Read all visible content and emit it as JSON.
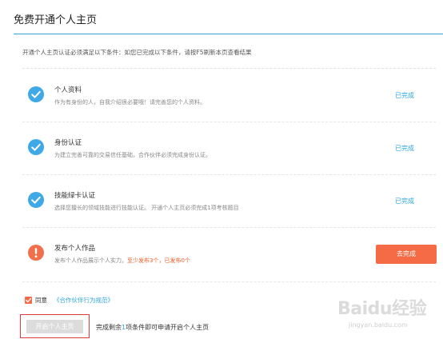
{
  "header": {
    "title": "免费开通个人主页"
  },
  "intro": {
    "text": "开通个人主页认证必须满足以下条件：如您已完成以下条件，请按F5刷新本页查看结果"
  },
  "requirements": [
    {
      "name": "个人资料",
      "description": "作为有身份的人，自我介绍很必要哦！请完善您的个人资料。",
      "status": "done",
      "status_label": "已完成",
      "icon": "check-circle-icon"
    },
    {
      "name": "身份认证",
      "description": "为建立完善可靠的交易信任基础，合作伙伴必须完成身份认证。",
      "status": "done",
      "status_label": "已完成",
      "icon": "check-circle-icon"
    },
    {
      "name": "技能绿卡认证",
      "description": "选择您擅长的领域技能进行技能认证。  开通个人主页必须完成1项考核题目",
      "status": "done",
      "status_label": "已完成",
      "icon": "check-circle-icon"
    },
    {
      "name": "发布个人作品",
      "description_prefix": "发布个人作品展示个人实力。",
      "description_warning": "至少发布3个，已发布0个",
      "status": "todo",
      "action_label": "去完成",
      "icon": "exclamation-circle-icon"
    }
  ],
  "agreement": {
    "checked": true,
    "label": "同意",
    "link_text": "《合作伙伴行为规范》"
  },
  "open_homepage": {
    "button_label": "开启个人主页",
    "hint_prefix": "完成剩余",
    "hint_number": "1",
    "hint_suffix": "项条件即可申请开启个人主页"
  },
  "watermark": {
    "logo": "Baidu经验",
    "sub": "jingyan.baidu.com"
  },
  "colors": {
    "accent": "#2ea7e0",
    "action": "#f46b45",
    "warning_text": "#f15a24",
    "done_icon": "#3fa9e8",
    "alert_icon": "#f0704b",
    "disabled_button": "#dcdcdc",
    "highlight_border": "#e03b3b"
  }
}
